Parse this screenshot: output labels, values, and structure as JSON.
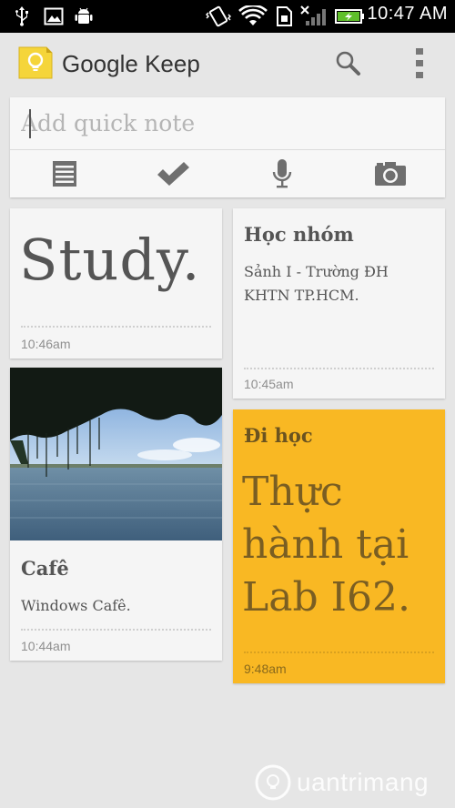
{
  "status_bar": {
    "time": "10:47 AM",
    "icons": [
      "usb-icon",
      "image-icon",
      "android-icon",
      "vibrate-icon",
      "wifi-icon",
      "sim-icon",
      "signal-icon",
      "battery-charging-icon"
    ]
  },
  "app_bar": {
    "title": "Google Keep",
    "icons": [
      "keep-logo-icon",
      "search-icon",
      "overflow-menu-icon"
    ]
  },
  "quick_note": {
    "placeholder": "Add quick note",
    "value": "",
    "actions": [
      "text-note-icon",
      "checklist-icon",
      "microphone-icon",
      "camera-icon"
    ]
  },
  "notes": [
    {
      "id": "study",
      "title": "",
      "body": "Study.",
      "time": "10:46am",
      "color": "#f5f5f5"
    },
    {
      "id": "hoc-nhom",
      "title": "Học nhóm",
      "body": "Sảnh I - Trường ĐH KHTN TP.HCM.",
      "time": "10:45am",
      "color": "#f5f5f5"
    },
    {
      "id": "cafe",
      "title": "Cafê",
      "body": "Windows Cafê.",
      "time": "10:44am",
      "color": "#f5f5f5",
      "image": "lake-trees-photo"
    },
    {
      "id": "di-hoc",
      "title": "Đi học",
      "body": "Thực hành tại Lab I62.",
      "time": "9:48am",
      "color": "#f9b823"
    }
  ],
  "watermark": {
    "text": "uantrimang"
  },
  "colors": {
    "background": "#e6e6e6",
    "card": "#f5f5f5",
    "accent_yellow": "#f9b823",
    "logo_yellow": "#f5d53a"
  }
}
